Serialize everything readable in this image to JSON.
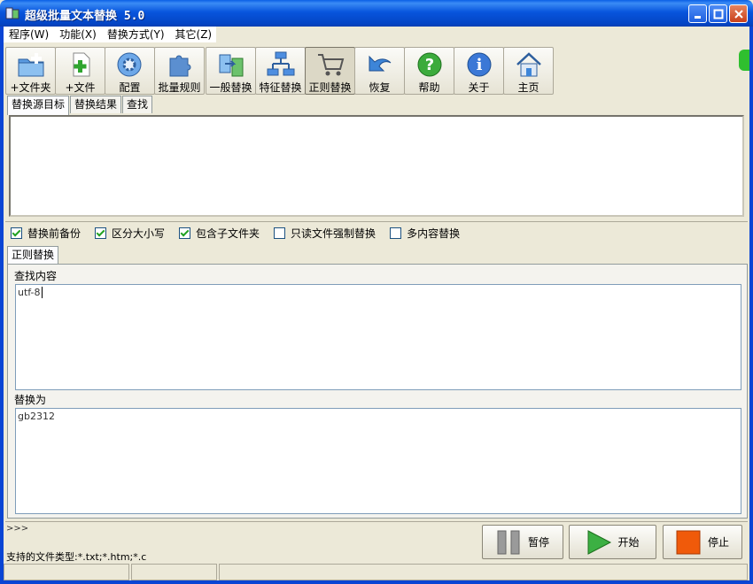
{
  "window": {
    "title": "超级批量文本替换 5.0"
  },
  "menu": [
    "程序(W)",
    "功能(X)",
    "替换方式(Y)",
    "其它(Z)"
  ],
  "toolbar": [
    {
      "label": "+文件夹",
      "icon": "folder-add-icon"
    },
    {
      "label": "+文件",
      "icon": "file-add-icon"
    },
    {
      "label": "配置",
      "icon": "gear-icon"
    },
    {
      "label": "批量规则",
      "icon": "puzzle-icon"
    },
    {
      "label": "一般替换",
      "icon": "swap-icon"
    },
    {
      "label": "特征替换",
      "icon": "network-icon"
    },
    {
      "label": "正则替换",
      "icon": "cart-icon"
    },
    {
      "label": "恢复",
      "icon": "undo-arrow-icon"
    },
    {
      "label": "帮助",
      "icon": "help-icon"
    },
    {
      "label": "关于",
      "icon": "info-icon"
    },
    {
      "label": "主页",
      "icon": "home-icon"
    }
  ],
  "source_tabs": [
    "替换源目标",
    "替换结果",
    "查找"
  ],
  "options": [
    {
      "label": "替换前备份",
      "checked": true
    },
    {
      "label": "区分大小写",
      "checked": true
    },
    {
      "label": "包含子文件夹",
      "checked": true
    },
    {
      "label": "只读文件强制替换",
      "checked": false
    },
    {
      "label": "多内容替换",
      "checked": false
    }
  ],
  "regex_tab": "正则替换",
  "find": {
    "label": "查找内容",
    "value": "utf-8"
  },
  "replace": {
    "label": "替换为",
    "value": "gb2312"
  },
  "log": {
    "prompt": ">>>",
    "types_text": "支持的文件类型:*.txt;*.htm;*.c"
  },
  "actions": {
    "pause": "暂停",
    "start": "开始",
    "stop": "停止"
  },
  "colors": {
    "titlebar": "#0855dd",
    "start_green": "#3cb043",
    "stop_orange": "#f05a0a"
  }
}
